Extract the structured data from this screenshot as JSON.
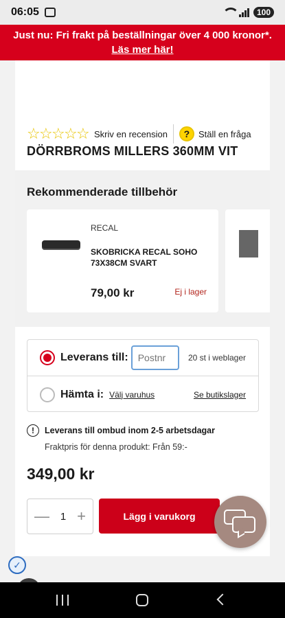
{
  "status_bar": {
    "time": "06:05",
    "battery": "100"
  },
  "banner": {
    "line1": "Just nu: Fri frakt på beställningar över 4 000 kronor*.",
    "line2": "Läs mer här!"
  },
  "product": {
    "review_label": "Skriv en recension",
    "ask_label": "Ställ en fråga",
    "title": "DÖRRBROMS MILLERS 360MM VIT",
    "price": "349,00 kr"
  },
  "accessories": {
    "heading": "Rekommenderade tillbehör",
    "items": [
      {
        "brand": "RECAL",
        "name": "SKOBRICKA RECAL SOHO 73X38CM SVART",
        "price": "79,00 kr",
        "stock": "Ej i lager"
      }
    ]
  },
  "delivery": {
    "delivery_label": "Leverans till:",
    "postnr_placeholder": "Postnr",
    "web_stock": "20 st i weblager",
    "pickup_label": "Hämta i:",
    "choose_store": "Välj varuhus",
    "store_stock": "Se butikslager",
    "info": "Leverans till ombud inom 2-5 arbetsdagar",
    "freight": "Fraktpris för denna produkt: Från 59:-"
  },
  "cart": {
    "qty": "1",
    "add_label": "Lägg i varukorg"
  },
  "icons": {
    "rating": "star-outline-icon",
    "question": "question-mark-icon",
    "info": "info-icon",
    "chat": "chat-icon",
    "verify": "verified-check-icon",
    "phone": "phone-icon"
  },
  "colors": {
    "brand_red": "#d6001c",
    "star_yellow": "#e8c400",
    "chat_bg": "#a58980"
  }
}
